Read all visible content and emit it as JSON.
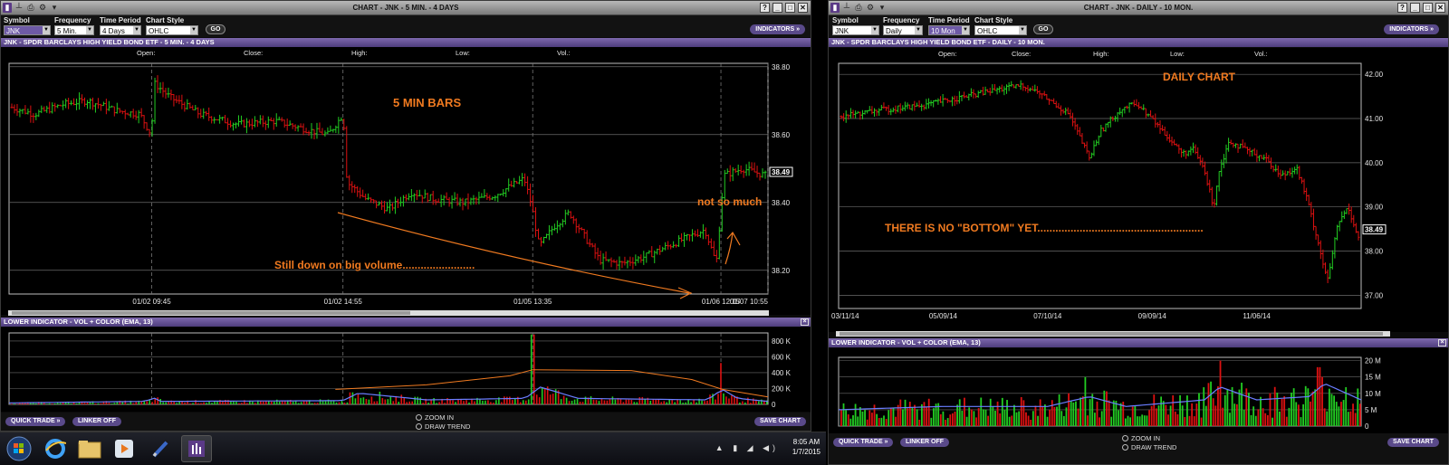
{
  "left": {
    "title": "CHART - JNK - 5 MIN. - 4 DAYS",
    "controls": {
      "symbol_label": "Symbol",
      "symbol_value": "JNK",
      "frequency_label": "Frequency",
      "frequency_value": "5 Min.",
      "period_label": "Time Period",
      "period_value": "4 Days",
      "style_label": "Chart Style",
      "style_value": "OHLC",
      "go": "GO",
      "indicators": "INDICATORS »"
    },
    "chart_header": "JNK - SPDR BARCLAYS HIGH YIELD BOND ETF - 5 MIN. - 4 DAYS",
    "ohlc": {
      "open": "Open:",
      "close": "Close:",
      "high": "High:",
      "low": "Low:",
      "vol": "Vol.:"
    },
    "lower_header": "LOWER INDICATOR - VOL + COLOR (EMA, 13)",
    "quick_trade": "QUICK TRADE »",
    "linker": "LINKER OFF",
    "zoom_in": "ZOOM IN",
    "draw_trend": "DRAW TREND",
    "save_chart": "SAVE CHART"
  },
  "right": {
    "title": "CHART - JNK - DAILY - 10 MON.",
    "controls": {
      "symbol_label": "Symbol",
      "symbol_value": "JNK",
      "frequency_label": "Frequency",
      "frequency_value": "Daily",
      "period_label": "Time Period",
      "period_value": "10 Mon",
      "style_label": "Chart Style",
      "style_value": "OHLC",
      "go": "GO",
      "indicators": "INDICATORS »"
    },
    "chart_header": "JNK - SPDR BARCLAYS HIGH YIELD BOND ETF - DAILY - 10 MON.",
    "ohlc": {
      "open": "Open:",
      "close": "Close:",
      "high": "High:",
      "low": "Low:",
      "vol": "Vol.:"
    },
    "lower_header": "LOWER INDICATOR - VOL + COLOR (EMA, 13)",
    "quick_trade": "QUICK TRADE »",
    "linker": "LINKER OFF",
    "zoom_in": "ZOOM IN",
    "draw_trend": "DRAW TREND",
    "save_chart": "SAVE CHART"
  },
  "taskbar": {
    "time": "8:05 AM",
    "date": "1/7/2015"
  },
  "colors": {
    "up": "#22cc22",
    "down": "#dd1111",
    "annotation": "#f07a20",
    "ema": "#6a7dff",
    "grid": "#6a6a6a"
  },
  "chart_data": [
    {
      "type": "ohlc",
      "panel": "left-price",
      "x_tick_labels": [
        "01/02 09:45",
        "01/02 14:55",
        "01/05 13:35",
        "01/06 12:15",
        "01/07 10:55"
      ],
      "y_ticks": [
        38.2,
        38.4,
        38.6,
        38.8
      ],
      "y_tick_labels": [
        "38.20",
        "38.40",
        "38.60",
        "38.80"
      ],
      "ylim": [
        38.13,
        38.81
      ],
      "last_price": "38.49",
      "annotations": [
        "5 MIN BARS",
        "not so much",
        "Still down on big volume........................"
      ],
      "price_path": [
        [
          0,
          38.68
        ],
        [
          0.03,
          38.66
        ],
        [
          0.07,
          38.69
        ],
        [
          0.1,
          38.7
        ],
        [
          0.14,
          38.67
        ],
        [
          0.17,
          38.66
        ],
        [
          0.185,
          38.6
        ],
        [
          0.19,
          38.75
        ],
        [
          0.21,
          38.71
        ],
        [
          0.25,
          38.66
        ],
        [
          0.3,
          38.63
        ],
        [
          0.35,
          38.64
        ],
        [
          0.4,
          38.61
        ],
        [
          0.42,
          38.6
        ],
        [
          0.44,
          38.66
        ],
        [
          0.445,
          38.46
        ],
        [
          0.47,
          38.41
        ],
        [
          0.5,
          38.38
        ],
        [
          0.53,
          38.43
        ],
        [
          0.56,
          38.41
        ],
        [
          0.6,
          38.4
        ],
        [
          0.64,
          38.42
        ],
        [
          0.68,
          38.47
        ],
        [
          0.69,
          38.39
        ],
        [
          0.7,
          38.27
        ],
        [
          0.72,
          38.33
        ],
        [
          0.74,
          38.37
        ],
        [
          0.76,
          38.3
        ],
        [
          0.78,
          38.23
        ],
        [
          0.81,
          38.22
        ],
        [
          0.84,
          38.24
        ],
        [
          0.87,
          38.27
        ],
        [
          0.9,
          38.3
        ],
        [
          0.92,
          38.32
        ],
        [
          0.935,
          38.22
        ],
        [
          0.945,
          38.48
        ],
        [
          0.97,
          38.5
        ],
        [
          1.0,
          38.48
        ]
      ]
    },
    {
      "type": "bar",
      "panel": "left-volume",
      "y_tick_labels": [
        "0",
        "200 K",
        "400 K",
        "600 K",
        "800 K"
      ],
      "ylim": [
        0,
        950000
      ],
      "ema_path": [
        [
          0,
          20000
        ],
        [
          0.18,
          40000
        ],
        [
          0.19,
          90000
        ],
        [
          0.2,
          40000
        ],
        [
          0.44,
          50000
        ],
        [
          0.46,
          150000
        ],
        [
          0.55,
          60000
        ],
        [
          0.68,
          80000
        ],
        [
          0.7,
          230000
        ],
        [
          0.75,
          80000
        ],
        [
          0.92,
          60000
        ],
        [
          0.94,
          200000
        ],
        [
          0.96,
          80000
        ],
        [
          1.0,
          40000
        ]
      ],
      "trend_path": [
        [
          0.43,
          200000
        ],
        [
          0.55,
          260000
        ],
        [
          0.66,
          380000
        ],
        [
          0.69,
          460000
        ],
        [
          0.82,
          450000
        ],
        [
          0.9,
          330000
        ],
        [
          0.94,
          200000
        ],
        [
          1.0,
          100000
        ]
      ],
      "spikes": [
        [
          0.69,
          930000
        ],
        [
          0.94,
          550000
        ],
        [
          0.45,
          160000
        ],
        [
          0.19,
          80000
        ]
      ]
    },
    {
      "type": "ohlc",
      "panel": "right-price",
      "x_tick_labels": [
        "03/11/14",
        "05/09/14",
        "07/10/14",
        "09/09/14",
        "11/06/14"
      ],
      "y_ticks": [
        37,
        38,
        39,
        40,
        41,
        42
      ],
      "y_tick_labels": [
        "37.00",
        "38.00",
        "39.00",
        "40.00",
        "41.00",
        "42.00"
      ],
      "ylim": [
        36.7,
        42.25
      ],
      "last_price": "38.49",
      "annotations": [
        "DAILY CHART",
        "THERE IS NO \"BOTTOM\" YET......................................................."
      ],
      "price_path": [
        [
          0,
          41.05
        ],
        [
          0.08,
          41.2
        ],
        [
          0.16,
          41.3
        ],
        [
          0.24,
          41.5
        ],
        [
          0.3,
          41.65
        ],
        [
          0.35,
          41.75
        ],
        [
          0.38,
          41.6
        ],
        [
          0.44,
          41.1
        ],
        [
          0.48,
          40.1
        ],
        [
          0.5,
          40.7
        ],
        [
          0.54,
          41.2
        ],
        [
          0.57,
          41.35
        ],
        [
          0.6,
          41.0
        ],
        [
          0.63,
          40.6
        ],
        [
          0.66,
          40.2
        ],
        [
          0.68,
          40.3
        ],
        [
          0.7,
          39.9
        ],
        [
          0.72,
          39.0
        ],
        [
          0.73,
          39.8
        ],
        [
          0.75,
          40.5
        ],
        [
          0.78,
          40.3
        ],
        [
          0.82,
          40.1
        ],
        [
          0.85,
          39.7
        ],
        [
          0.88,
          39.9
        ],
        [
          0.9,
          39.2
        ],
        [
          0.92,
          38.3
        ],
        [
          0.94,
          37.3
        ],
        [
          0.96,
          38.6
        ],
        [
          0.98,
          39.0
        ],
        [
          1.0,
          38.3
        ]
      ]
    },
    {
      "type": "bar",
      "panel": "right-volume",
      "y_tick_labels": [
        "0",
        "5 M",
        "10 M",
        "15 M",
        "20 M"
      ],
      "ylim": [
        0,
        21000000
      ],
      "ema_path": [
        [
          0,
          5000000
        ],
        [
          0.2,
          6000000
        ],
        [
          0.4,
          6000000
        ],
        [
          0.48,
          9000000
        ],
        [
          0.55,
          6000000
        ],
        [
          0.7,
          8000000
        ],
        [
          0.73,
          12000000
        ],
        [
          0.8,
          8000000
        ],
        [
          0.9,
          9000000
        ],
        [
          0.93,
          13000000
        ],
        [
          1.0,
          8000000
        ]
      ],
      "spikes": [
        [
          0.73,
          20000000
        ],
        [
          0.92,
          18000000
        ],
        [
          0.47,
          15000000
        ]
      ]
    }
  ]
}
